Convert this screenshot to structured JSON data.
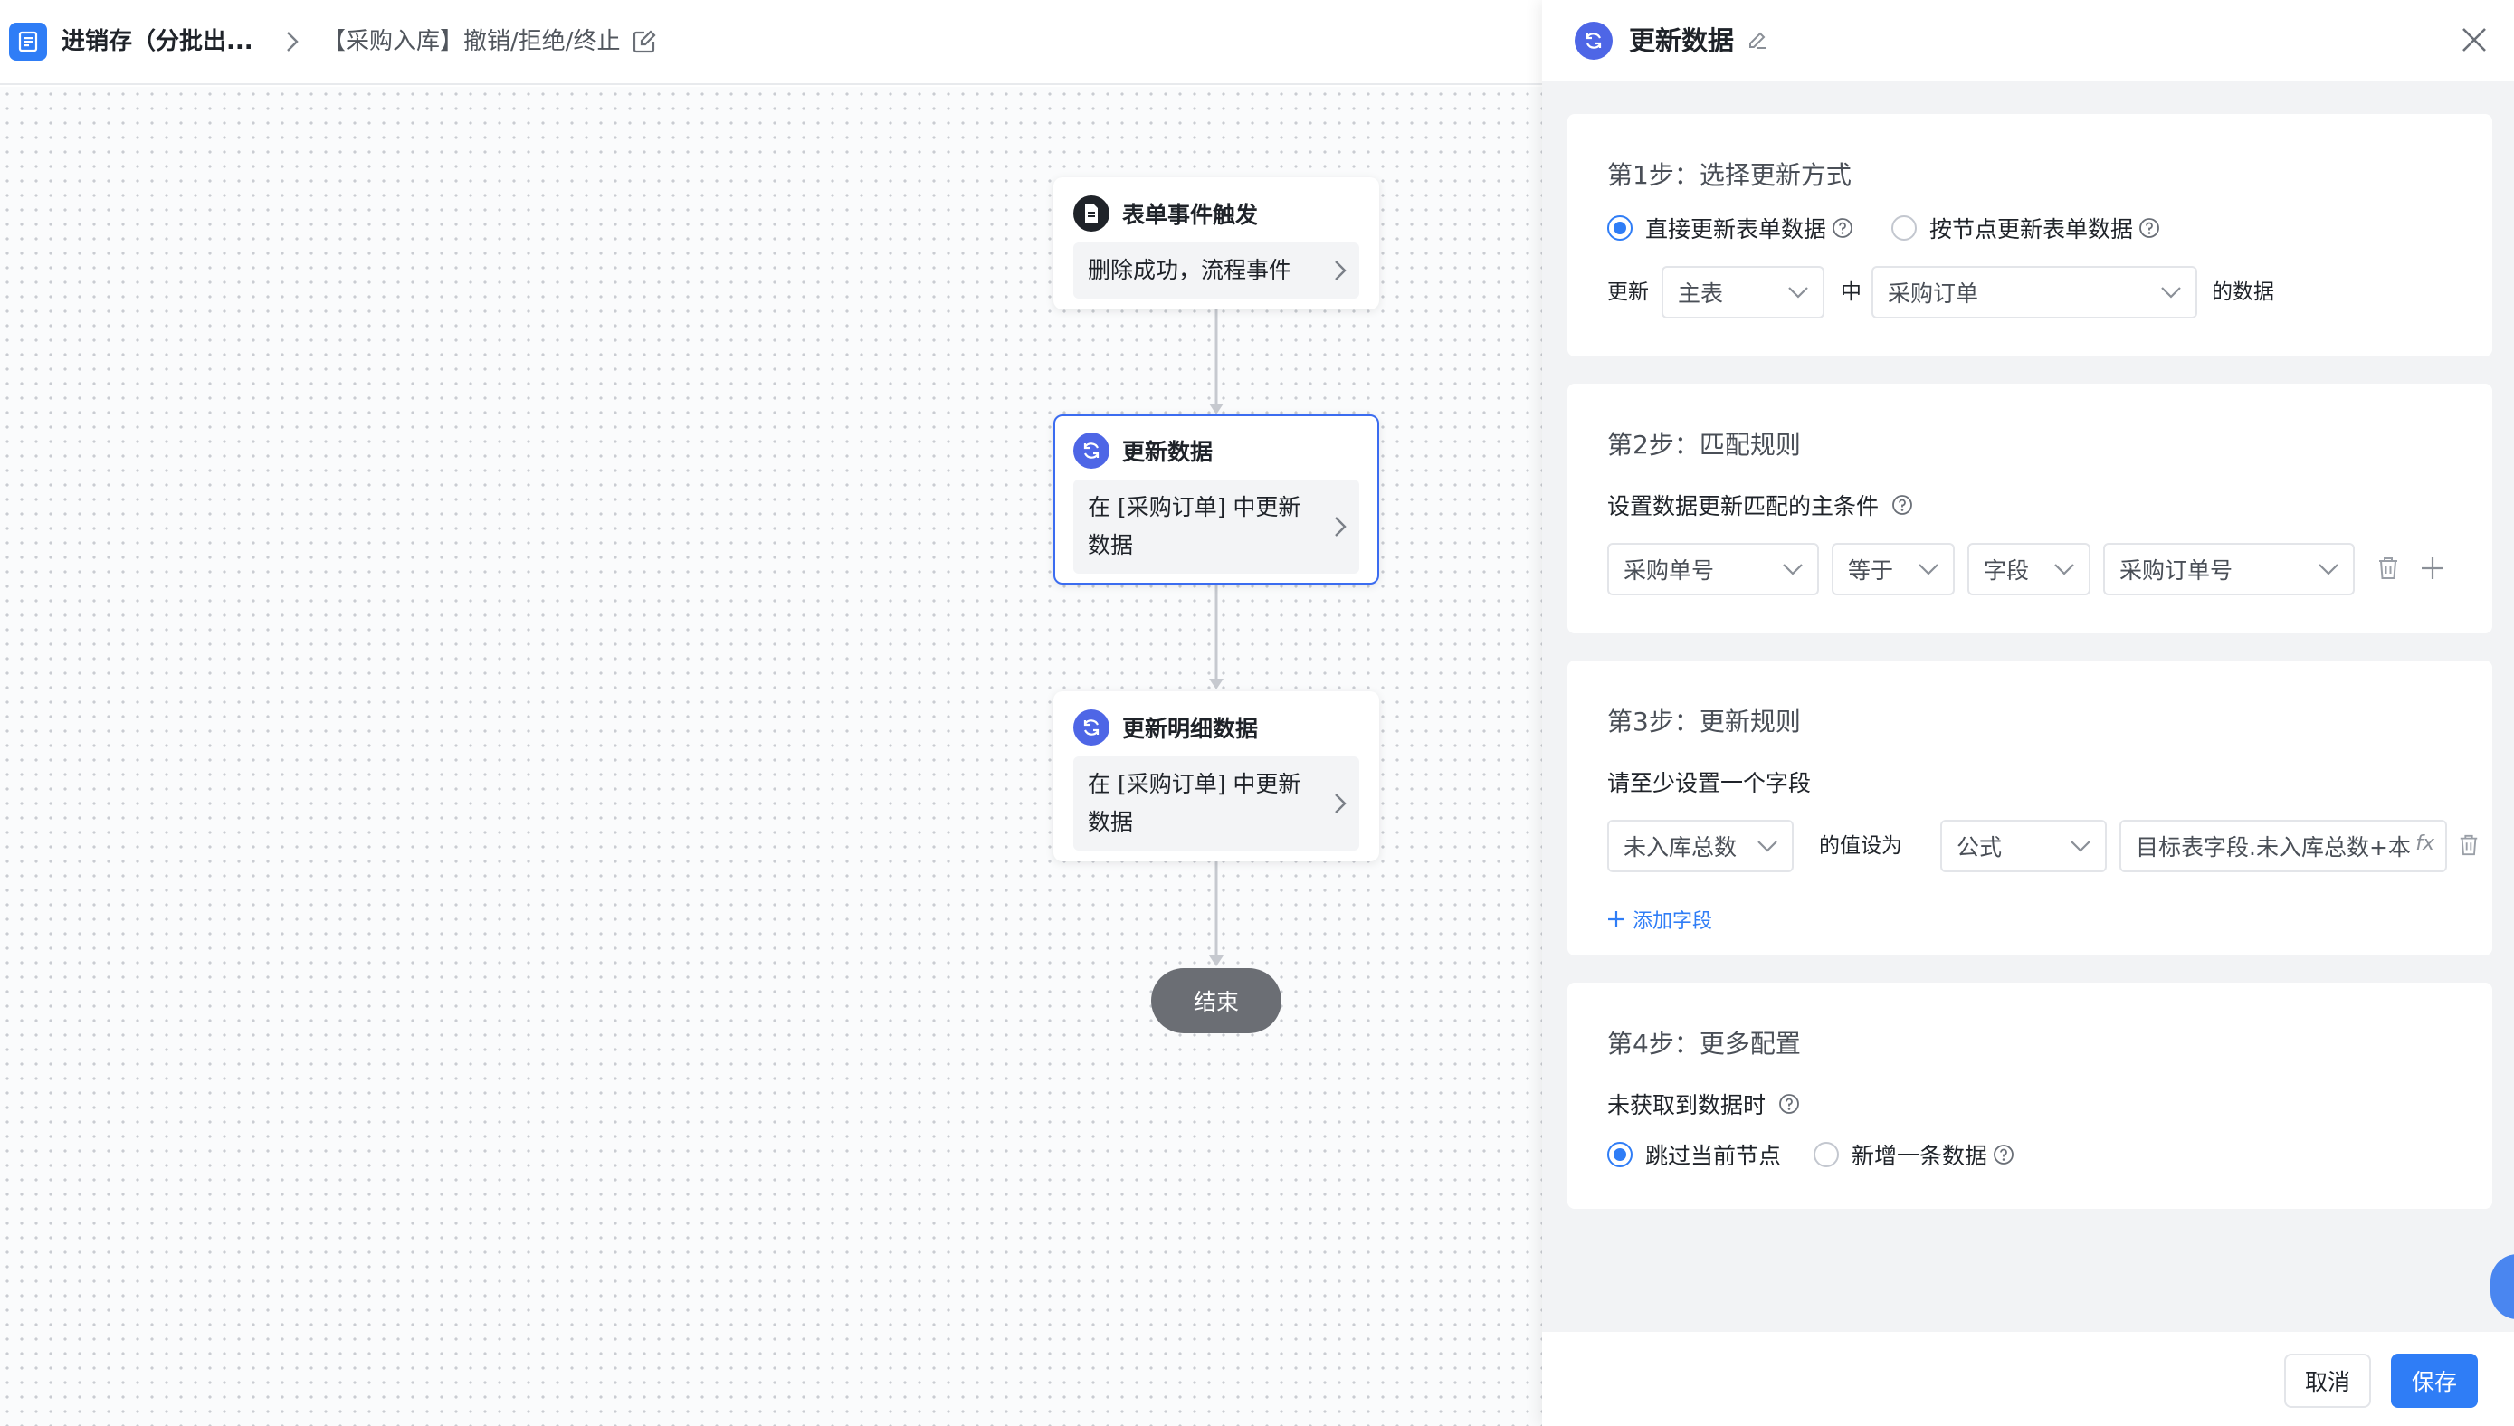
{
  "header": {
    "app_name": "进销存（分批出...",
    "workflow_name": "【采购入库】撤销/拒绝/终止"
  },
  "nodes": {
    "trigger": {
      "title": "表单事件触发",
      "body": "删除成功，流程事件"
    },
    "update": {
      "title": "更新数据",
      "body": "在 [采购订单] 中更新数据"
    },
    "update_detail": {
      "title": "更新明细数据",
      "body": "在 [采购订单] 中更新数据"
    },
    "end": {
      "label": "结束"
    }
  },
  "panel": {
    "title": "更新数据",
    "step1": {
      "title": "第1步：选择更新方式",
      "option_direct": "直接更新表单数据",
      "option_by_node": "按节点更新表单数据",
      "selected": "direct",
      "update_label": "更新",
      "table_select": "主表",
      "in_label": "中",
      "form_select": "采购订单",
      "data_suffix": "的数据"
    },
    "step2": {
      "title": "第2步：匹配规则",
      "subtitle": "设置数据更新匹配的主条件",
      "field_select": "采购单号",
      "operator_select": "等于",
      "value_type_select": "字段",
      "value_field_select": "采购订单号"
    },
    "step3": {
      "title": "第3步：更新规则",
      "subtitle": "请至少设置一个字段",
      "field_select": "未入库总数",
      "set_value_label": "的值设为",
      "value_type_select": "公式",
      "formula_value": "目标表字段.未入库总数+本",
      "add_field": "添加字段"
    },
    "step4": {
      "title": "第4步：更多配置",
      "subtitle": "未获取到数据时",
      "option_skip": "跳过当前节点",
      "option_add": "新增一条数据",
      "selected": "skip"
    },
    "footer": {
      "cancel": "取消",
      "save": "保存"
    }
  },
  "colors": {
    "primary": "#2f7df6",
    "node_icon": "#4e66e6",
    "end_node": "#6b6e74"
  }
}
